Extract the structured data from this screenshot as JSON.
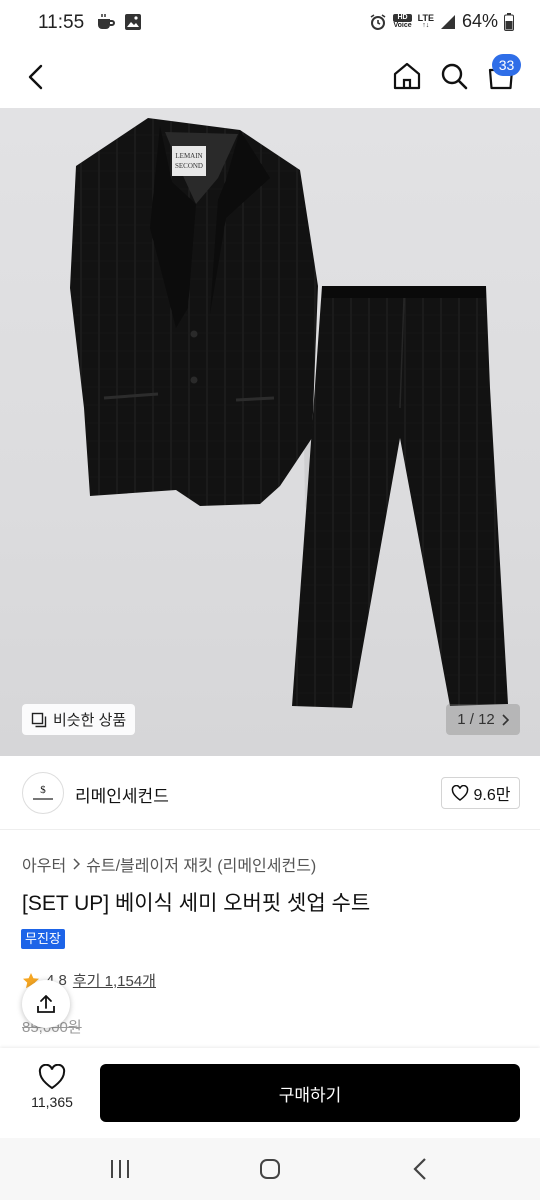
{
  "status_bar": {
    "time": "11:55",
    "hd_label": "HD",
    "voice_label": "Voice",
    "network": "LTE",
    "battery": "64%"
  },
  "header": {
    "cart_count": "33"
  },
  "image": {
    "similar_label": "비슷한 상품",
    "pager": "1 / 12",
    "label_text_1": "LEMAIN",
    "label_text_2": "SECOND"
  },
  "brand": {
    "name": "리메인세컨드",
    "likes": "9.6만"
  },
  "breadcrumb": {
    "category": "아우터",
    "subcategory": "슈트/블레이저 재킷 (리메인세컨드)"
  },
  "product": {
    "title": "[SET UP] 베이식 세미 오버핏 셋업 수트",
    "shipping_badge": "무진장",
    "rating": "4.8",
    "reviews": "후기 1,154개",
    "original_price": "85,000원"
  },
  "action_bar": {
    "wish_count": "11,365",
    "buy_label": "구매하기"
  },
  "colors": {
    "accent": "#1d64e8",
    "badge": "#2f6ee8",
    "buy": "#000000",
    "star": "#f5a623"
  }
}
